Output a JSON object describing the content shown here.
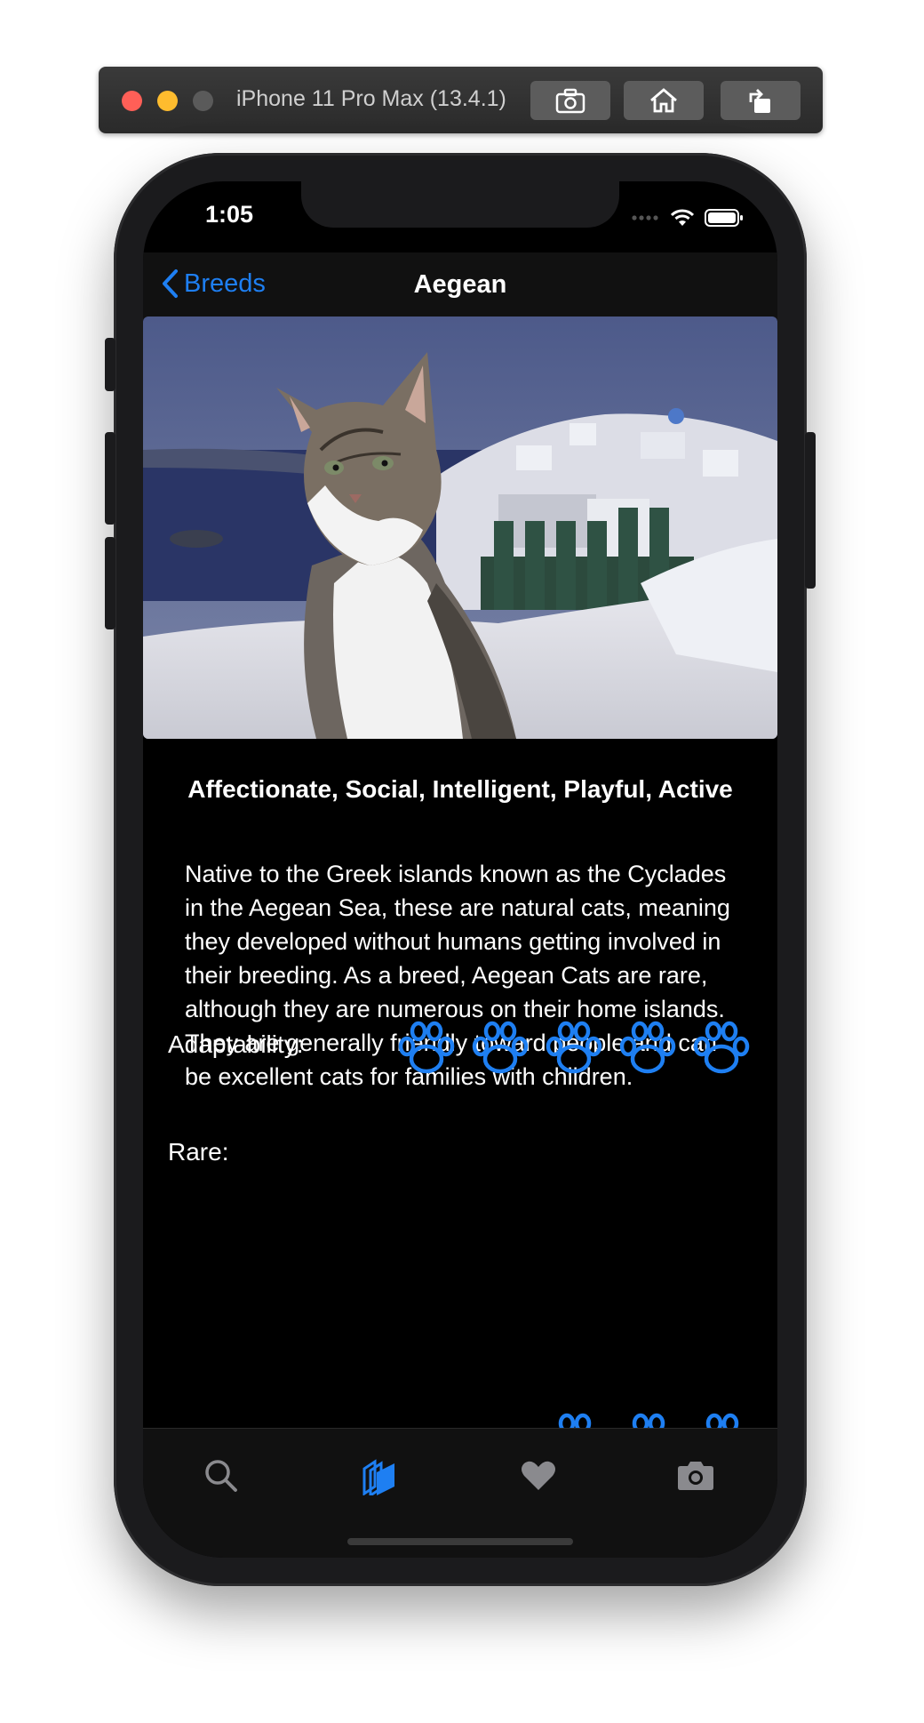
{
  "simulator": {
    "device_title": "iPhone 11 Pro Max (13.4.1)",
    "buttons": [
      "screenshot-icon",
      "home-icon",
      "rotate-icon"
    ]
  },
  "status_bar": {
    "time": "1:05"
  },
  "nav": {
    "back_label": "Breeds",
    "title": "Aegean"
  },
  "breed": {
    "temperament": "Affectionate, Social, Intelligent, Playful, Active",
    "description": "Native to the Greek islands known as the Cyclades in the Aegean Sea, these are natural cats, meaning they developed without humans getting involved in their breeding. As a breed, Aegean Cats are rare, although they are numerous on their home islands. They are generally friendly toward people and can be excellent cats for families with children.",
    "ratings": [
      {
        "label": "Adaptability:",
        "score": 5,
        "max": 5
      },
      {
        "label": "Rare:",
        "score": null,
        "max": 5
      }
    ]
  },
  "tabs": [
    {
      "name": "search-icon",
      "active": false
    },
    {
      "name": "breeds-icon",
      "active": true
    },
    {
      "name": "heart-icon",
      "active": false
    },
    {
      "name": "camera-icon",
      "active": false
    }
  ],
  "colors": {
    "accent": "#1e7ff2",
    "background": "#000000",
    "bar": "#111111"
  }
}
